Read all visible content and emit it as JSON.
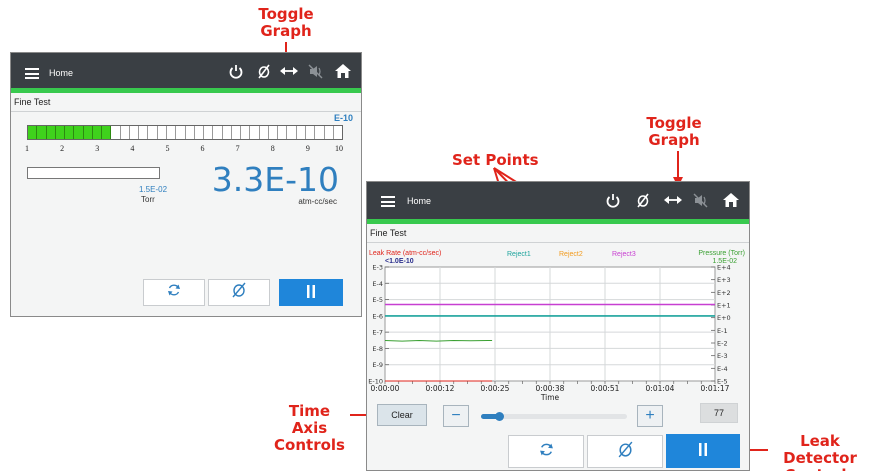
{
  "callouts": {
    "toggle_graph_1": "Toggle Graph",
    "toggle_graph_2": "Toggle Graph",
    "set_points": "Set Points",
    "time_axis": "Time Axis Controls",
    "leak_detector": "Leak Detector Controls"
  },
  "colors": {
    "header_bg": "#3a3f44",
    "header_accent": "#38c94e",
    "primary_blue": "#1f86da",
    "value_blue": "#2f7fbf",
    "bar_green": "#3fd21c",
    "callout_red": "#e0241b"
  },
  "screen1": {
    "header": {
      "title": "Home",
      "icons": [
        "menu-icon",
        "power-icon",
        "zero-icon",
        "toggle-graph-icon",
        "mute-icon",
        "home-icon"
      ]
    },
    "subtitle": "Fine Test",
    "bar_scale_unit": "E-10",
    "bar_ticks": [
      "1",
      "2",
      "3",
      "4",
      "5",
      "6",
      "7",
      "8",
      "9",
      "10"
    ],
    "bar_fill_fraction": 0.27,
    "pressure_bar_fraction": 0.0,
    "pressure_value": "1.5E-02",
    "pressure_unit": "Torr",
    "leak_value": "3.3E-10",
    "leak_unit": "atm-cc/sec",
    "buttons": [
      "refresh-icon",
      "zero-icon",
      "pause-icon"
    ]
  },
  "screen2": {
    "header": {
      "title": "Home",
      "icons": [
        "menu-icon",
        "power-icon",
        "zero-icon",
        "toggle-graph-icon",
        "mute-icon",
        "home-icon"
      ]
    },
    "subtitle": "Fine Test",
    "chart_labels": {
      "left_axis_title": "Leak Rate (atm-cc/sec)",
      "left_axis_value": "<1.0E-10",
      "right_axis_title": "Pressure (Torr)",
      "right_axis_value": "1.5E-02",
      "reject1": "Reject1",
      "reject2": "Reject2",
      "reject3": "Reject3",
      "time_label": "Time"
    },
    "controls": {
      "clear_label": "Clear",
      "minus_label": "−",
      "plus_label": "+",
      "slider_fraction": 0.12,
      "count_value": "77"
    },
    "buttons": [
      "refresh-icon",
      "zero-icon",
      "pause-icon"
    ]
  },
  "chart_data": {
    "type": "line",
    "xlabel": "Time",
    "x_ticks": [
      "0:00:00",
      "0:00:12",
      "0:00:25",
      "0:00:38",
      "0:00:51",
      "0:01:04",
      "0:01:17"
    ],
    "xlim_seconds": [
      0,
      77
    ],
    "y_left_ticks": [
      "E-3",
      "E-4",
      "E-5",
      "E-6",
      "E-7",
      "E-8",
      "E-9",
      "E-10"
    ],
    "y_left_scale": "log",
    "y_left_exp_range": [
      -10,
      -3
    ],
    "y_right_ticks": [
      "E+4",
      "E+3",
      "E+2",
      "E+1",
      "E+0",
      "E-1",
      "E-2",
      "E-3",
      "E-4",
      "E-5"
    ],
    "y_right_scale": "log",
    "y_right_exp_range": [
      -5,
      4
    ],
    "grid": true,
    "series": [
      {
        "name": "Reject1",
        "color": "#1ba39c",
        "axis": "left",
        "x": [
          0,
          77
        ],
        "y_exp": [
          -6,
          -6
        ]
      },
      {
        "name": "Reject3",
        "color": "#c73fd1",
        "axis": "left",
        "x": [
          0,
          77
        ],
        "y_exp": [
          -5.3,
          -5.3
        ]
      },
      {
        "name": "Pressure (Torr)",
        "color": "#3aa032",
        "axis": "right",
        "x": [
          0,
          4,
          8,
          12,
          16,
          20,
          24,
          25
        ],
        "y_exp": [
          -1.8,
          -1.85,
          -1.8,
          -1.85,
          -1.8,
          -1.82,
          -1.8,
          -1.8
        ]
      },
      {
        "name": "Leak Rate (atm-cc/sec)",
        "color": "#e0241b",
        "axis": "left",
        "x": [
          0,
          25
        ],
        "y_exp": [
          -10,
          -10
        ]
      }
    ]
  }
}
